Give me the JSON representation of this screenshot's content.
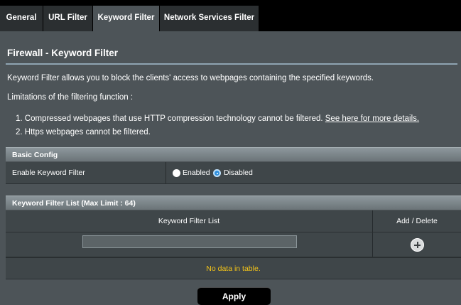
{
  "tabs": [
    {
      "label": "General"
    },
    {
      "label": "URL Filter"
    },
    {
      "label": "Keyword Filter"
    },
    {
      "label": "Network Services Filter"
    }
  ],
  "page_title": "Firewall - Keyword Filter",
  "description": "Keyword Filter allows you to block the clients' access to webpages containing the specified keywords.",
  "limitations_heading": "Limitations of the filtering function :",
  "limitations": {
    "item1_text": "1. Compressed webpages that use HTTP compression technology cannot be filtered.",
    "item1_link": "See here for more details.",
    "item2_text": "2. Https webpages cannot be filtered."
  },
  "basic_config": {
    "header": "Basic Config",
    "enable_label": "Enable Keyword Filter",
    "option_enabled": "Enabled",
    "option_disabled": "Disabled",
    "selected": "Disabled"
  },
  "keyword_list": {
    "header": "Keyword Filter List (Max Limit : 64)",
    "col_list": "Keyword Filter List",
    "col_action": "Add / Delete",
    "input_value": "",
    "empty_text": "No data in table."
  },
  "apply_label": "Apply",
  "colors": {
    "background": "#4d5458",
    "active_tab": "#4d5458",
    "inactive_tab": "#2b2f31",
    "section_header": "#7f898d",
    "empty_text": "#f5c518",
    "radio_selected": "#2f8fdc"
  }
}
